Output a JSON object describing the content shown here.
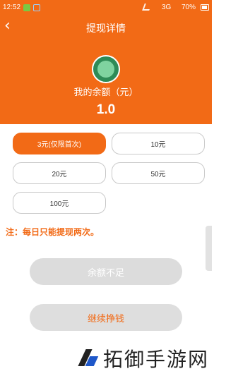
{
  "status_bar": {
    "time": "12:52",
    "network": "3G",
    "battery": "70%"
  },
  "header": {
    "title": "提现详情",
    "back_icon": "back-icon"
  },
  "balance": {
    "label": "我的余额（元）",
    "value": "1.0"
  },
  "options": [
    {
      "label": "3元(仅限首次)",
      "selected": true
    },
    {
      "label": "10元",
      "selected": false
    },
    {
      "label": "20元",
      "selected": false
    },
    {
      "label": "50元",
      "selected": false
    },
    {
      "label": "100元",
      "selected": false
    }
  ],
  "note": "注：每日只能提现两次。",
  "buttons": {
    "insufficient": "余额不足",
    "continue": "继续挣钱"
  },
  "watermark": {
    "text": "拓御手游网"
  },
  "colors": {
    "accent": "#f26a16",
    "button_gray": "#dcdcdc"
  }
}
